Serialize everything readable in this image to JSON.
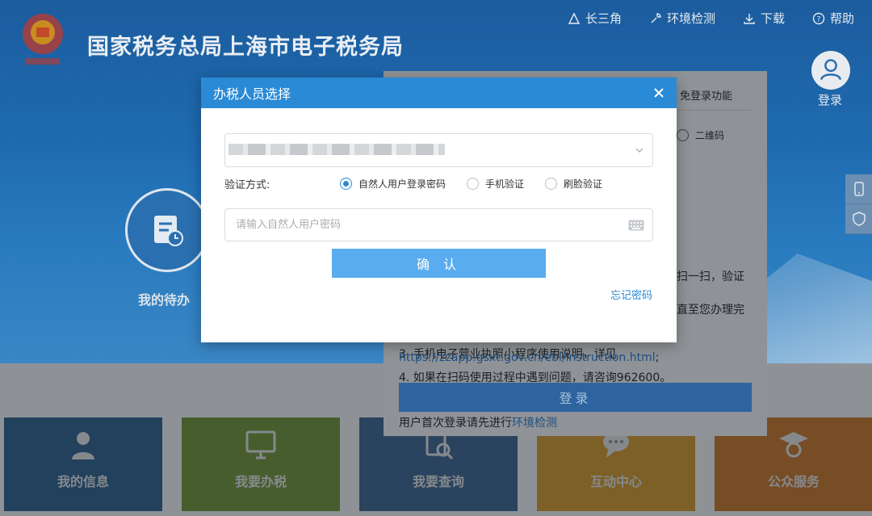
{
  "site": {
    "title": "国家税务总局上海市电子税务局"
  },
  "top_nav": [
    {
      "label": "长三角",
      "icon": "triangle-icon"
    },
    {
      "label": "环境检测",
      "icon": "wrench-icon"
    },
    {
      "label": "下载",
      "icon": "download-icon"
    },
    {
      "label": "帮助",
      "icon": "help-icon"
    }
  ],
  "user": {
    "login_label": "登录"
  },
  "hero": {
    "todo_label": "我的待办"
  },
  "tiles": [
    {
      "label": "我的信息",
      "color": "#2d6aa3"
    },
    {
      "label": "我要办税",
      "color": "#6d9a3a"
    },
    {
      "label": "我要查询",
      "color": "#3a6ea3"
    },
    {
      "label": "互动中心",
      "color": "#d49a2a"
    },
    {
      "label": "公众服务",
      "color": "#cf7a2a"
    }
  ],
  "login_panel": {
    "tab_label": "免登录功能",
    "radio_label": "二维码",
    "line1": "扫一扫，验证",
    "line2": "直至您办理完",
    "line3_prefix": "3. 手机电子营业执照小程序使用说明，详见",
    "line3_link": "https://zzapp.gsxt.gov.cn/ebl/instruction.html",
    "line3_suffix": ";",
    "line4": "4. 如果在扫码使用过程中遇到问题，请咨询962600。",
    "login_button": "登录",
    "hint_prefix": "用户首次登录请先进行",
    "hint_link": "环境检测"
  },
  "modal": {
    "title": "办税人员选择",
    "verify_label": "验证方式:",
    "options": [
      {
        "label": "自然人用户登录密码",
        "selected": true
      },
      {
        "label": "手机验证",
        "selected": false
      },
      {
        "label": "刷脸验证",
        "selected": false
      }
    ],
    "password_placeholder": "请输入自然人用户密码",
    "confirm_button": "确 认",
    "forgot_link": "忘记密码"
  },
  "colors": {
    "modal_header": "#2a8ad6",
    "confirm_button": "#58acef",
    "link": "#2a8ad6"
  }
}
